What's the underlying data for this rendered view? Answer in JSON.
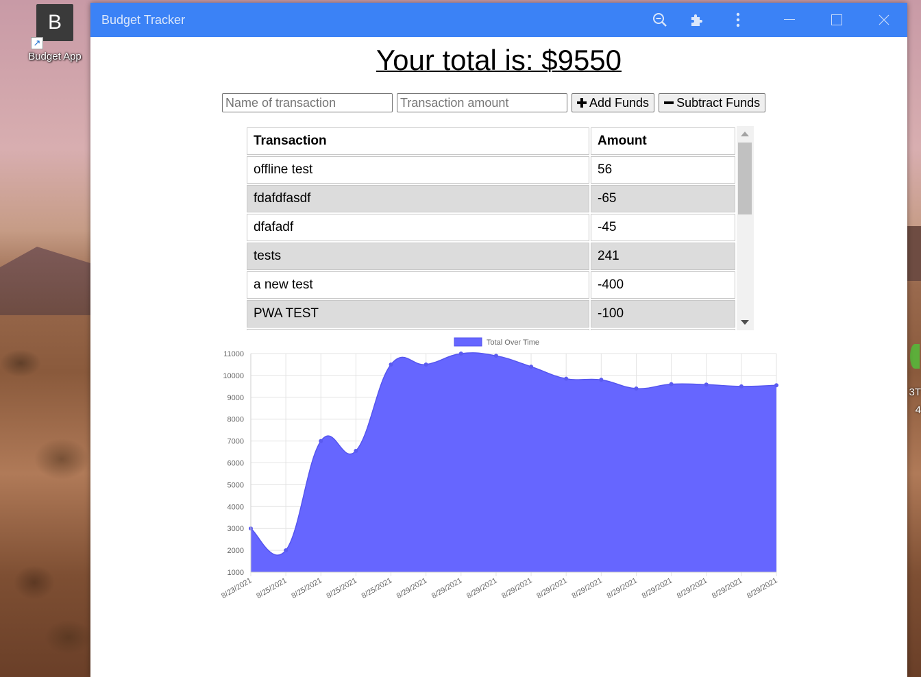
{
  "desktop": {
    "icon_letter": "B",
    "icon_label": "Budget App",
    "edge_text_1": "3T",
    "edge_text_2": "4"
  },
  "window": {
    "title": "Budget Tracker",
    "title_color": "#3b82f6"
  },
  "total": {
    "label": "Your total is: $",
    "value": "9550"
  },
  "form": {
    "name_placeholder": "Name of transaction",
    "amount_placeholder": "Transaction amount",
    "add_label": "Add Funds",
    "subtract_label": "Subtract Funds"
  },
  "table": {
    "headers": [
      "Transaction",
      "Amount"
    ],
    "rows": [
      {
        "name": "offline test",
        "amount": "56"
      },
      {
        "name": "fdafdfasdf",
        "amount": "-65"
      },
      {
        "name": "dfafadf",
        "amount": "-45"
      },
      {
        "name": "tests",
        "amount": "241"
      },
      {
        "name": "a new test",
        "amount": "-400"
      },
      {
        "name": "PWA TEST",
        "amount": "-100"
      }
    ]
  },
  "chart_data": {
    "type": "area",
    "series": [
      {
        "name": "Total Over Time",
        "color": "#6666ff",
        "values": [
          3000,
          2000,
          7000,
          6550,
          10500,
          10500,
          11000,
          10900,
          10400,
          9850,
          9800,
          9400,
          9600,
          9580,
          9500,
          9550
        ]
      }
    ],
    "x": [
      "8/23/2021",
      "8/25/2021",
      "8/25/2021",
      "8/25/2021",
      "8/25/2021",
      "8/29/2021",
      "8/29/2021",
      "8/29/2021",
      "8/29/2021",
      "8/29/2021",
      "8/29/2021",
      "8/29/2021",
      "8/29/2021",
      "8/29/2021",
      "8/29/2021",
      "8/29/2021"
    ],
    "ylim": [
      1000,
      11000
    ],
    "yticks": [
      1000,
      2000,
      3000,
      4000,
      5000,
      6000,
      7000,
      8000,
      9000,
      10000,
      11000
    ],
    "legend": "top-center",
    "grid": true
  }
}
